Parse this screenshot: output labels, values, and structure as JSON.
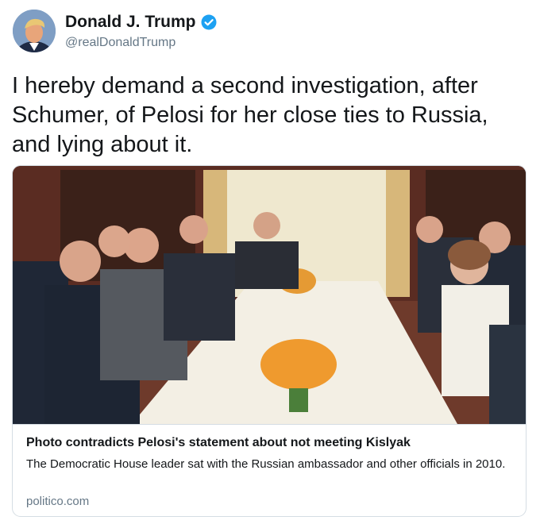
{
  "author": {
    "display_name": "Donald J. Trump",
    "handle": "@realDonaldTrump",
    "verified": true,
    "avatar_icon": "profile-photo"
  },
  "tweet": {
    "text": "I hereby demand a second investigation, after Schumer, of Pelosi for her close ties to Russia, and lying about it."
  },
  "link_card": {
    "image_icon": "photo-meeting-table",
    "title": "Photo contradicts Pelosi's statement about not meeting Kislyak",
    "description": "The Democratic House leader sat with the Russian ambassador and other officials in 2010.",
    "domain": "politico.com"
  },
  "colors": {
    "verified_blue": "#1da1f2",
    "text_primary": "#14171a",
    "text_secondary": "#657786",
    "card_border": "#d5dde3"
  }
}
